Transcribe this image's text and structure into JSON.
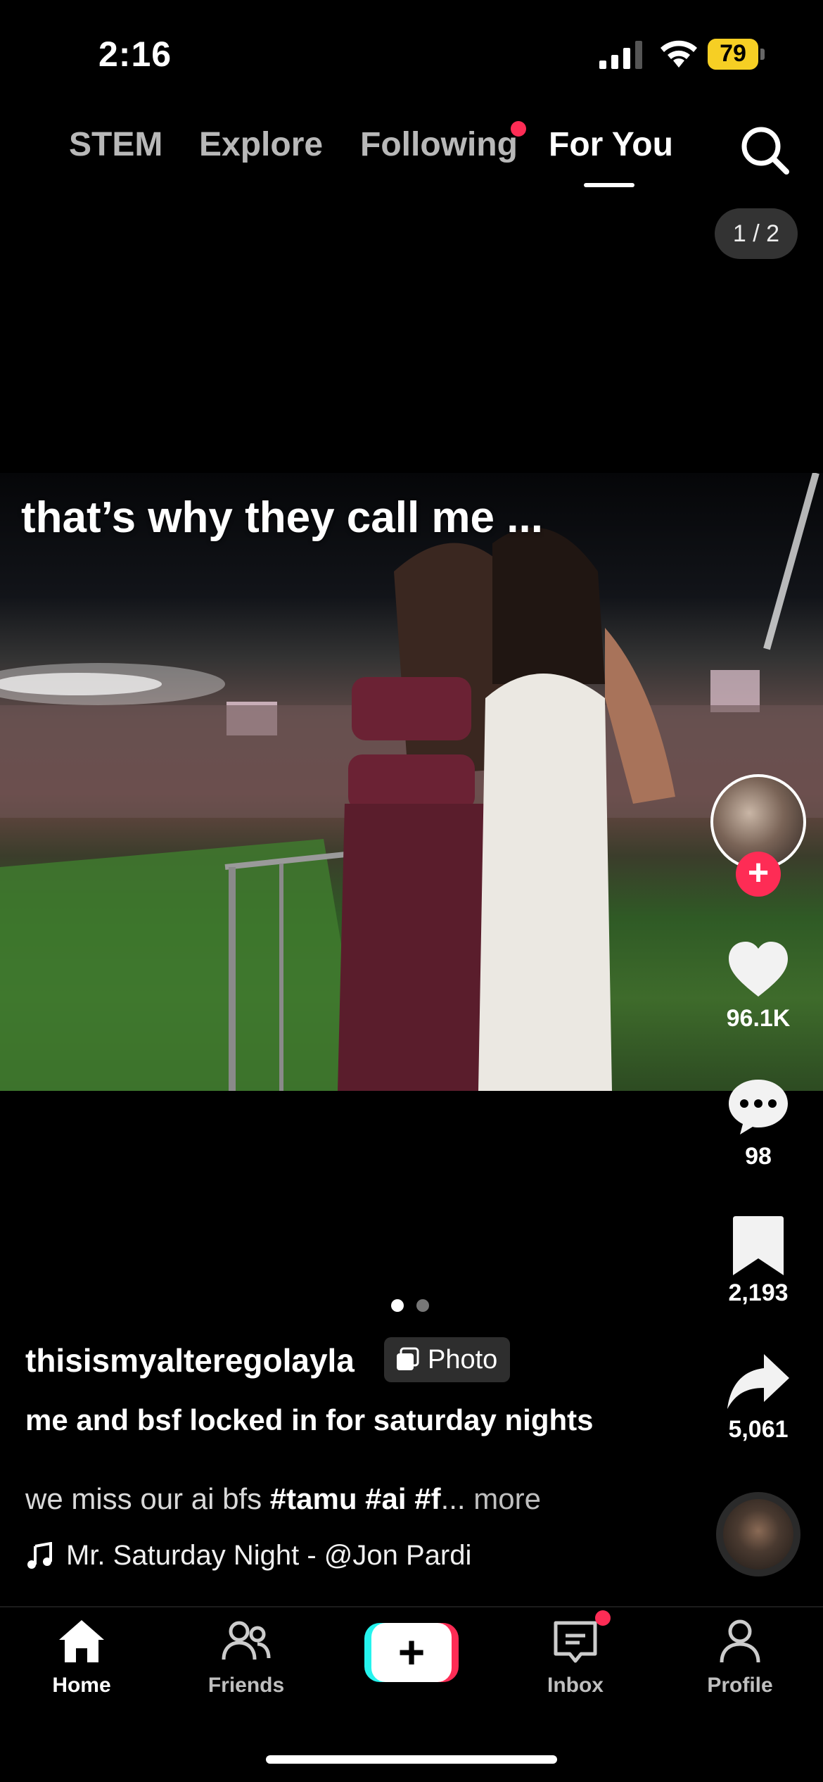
{
  "status_bar": {
    "time": "2:16",
    "battery": "79"
  },
  "tabs": [
    {
      "label": "STEM"
    },
    {
      "label": "Explore"
    },
    {
      "label": "Following"
    },
    {
      "label": "For You"
    }
  ],
  "counter": "1 / 2",
  "photo": {
    "overlay_text": "that’s why they call me ..."
  },
  "actions": {
    "likes": "96.1K",
    "comments": "98",
    "saves": "2,193",
    "shares": "5,061"
  },
  "post": {
    "username": "thisismyalteregolayla",
    "badge": "Photo",
    "title": "me and bsf locked in for saturday nights",
    "description_prefix": "we miss our ai bfs ",
    "tags": "#tamu #ai #f",
    "ellipsis": "...",
    "more": "more",
    "sound": "Mr. Saturday Night - @Jon Pardi"
  },
  "nav": {
    "home": "Home",
    "friends": "Friends",
    "inbox": "Inbox",
    "profile": "Profile",
    "create": "+"
  },
  "colors": {
    "accent": "#fe2c55",
    "cyan": "#25f4ee",
    "battery": "#f6cf24"
  }
}
